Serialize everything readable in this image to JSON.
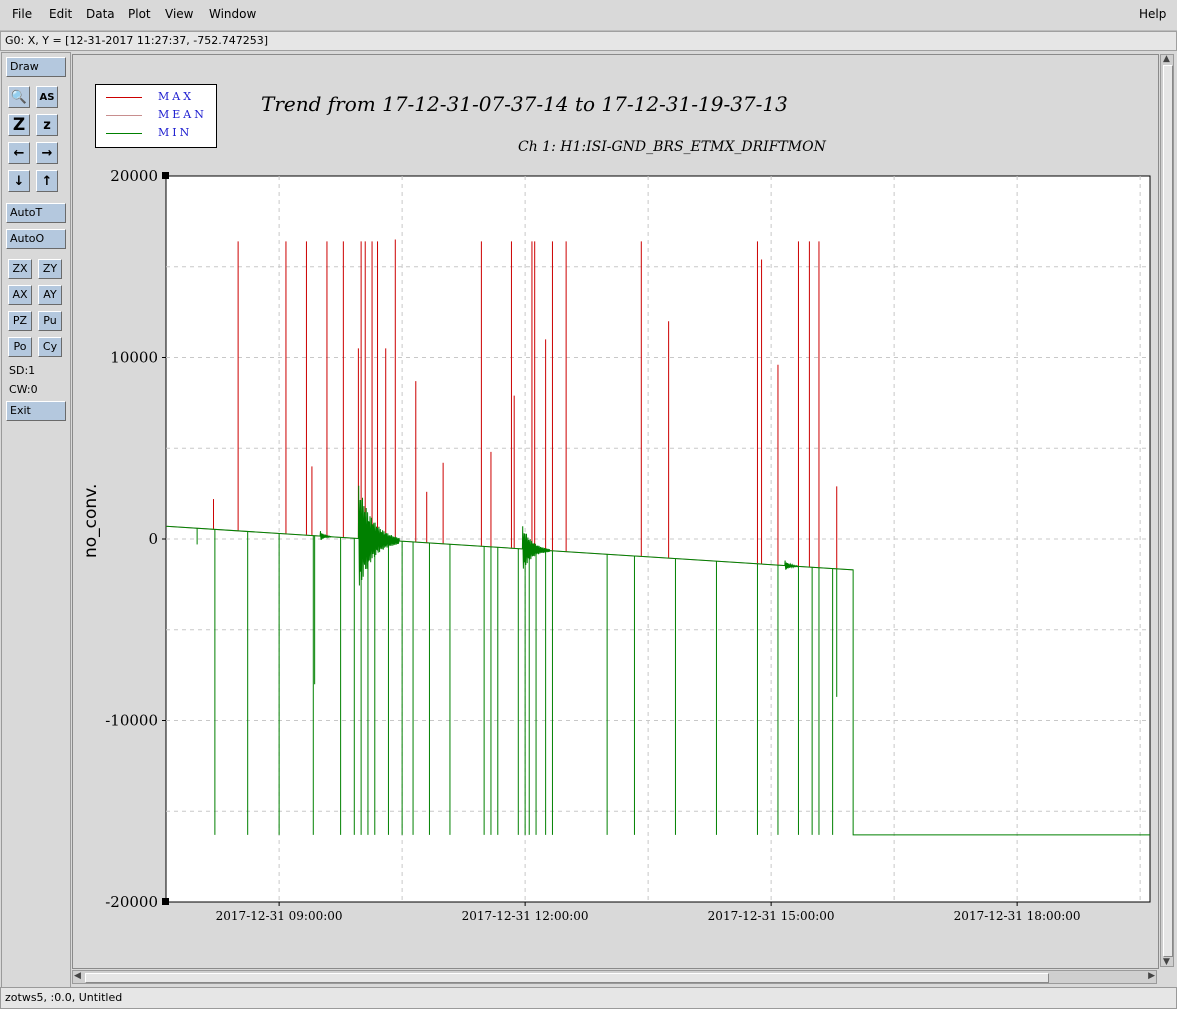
{
  "menubar": {
    "items": [
      "File",
      "Edit",
      "Data",
      "Plot",
      "View",
      "Window"
    ],
    "help": "Help"
  },
  "coordinate_readout": "G0: X, Y = [12-31-2017 11:27:37, -752.747253]",
  "sidebar": {
    "draw": "Draw",
    "icons": [
      "magnify-icon",
      "autoscale-icon",
      "zoom-out-icon",
      "zoom-in-icon",
      "pan-left-icon",
      "pan-right-icon",
      "pan-down-icon",
      "pan-up-icon"
    ],
    "icon_glyphs": [
      "🔍",
      "AS",
      "Z",
      "z",
      "←",
      "→",
      "↓",
      "↑"
    ],
    "autot": "AutoT",
    "autoo": "AutoO",
    "small_buttons": [
      "ZX",
      "ZY",
      "AX",
      "AY",
      "PZ",
      "Pu",
      "Po",
      "Cy"
    ],
    "sd": "SD:1",
    "cw": "CW:0",
    "exit": "Exit"
  },
  "status": "zotws5, :0.0, Untitled",
  "colors": {
    "max": "#cc0000",
    "mean": "#c88e8e",
    "min": "#008000",
    "button": "#b4c8de"
  },
  "chart_data": {
    "type": "line",
    "title": "Trend from 17-12-31-07-37-14 to 17-12-31-19-37-13",
    "subtitle": "Ch 1: H1:ISI-GND_BRS_ETMX_DRIFTMON",
    "ylabel": "no_conv.",
    "xlabel": "",
    "ylim": [
      -20000,
      20000
    ],
    "xlim": [
      "2017-12-31 07:37:14",
      "2017-12-31 19:37:13"
    ],
    "yticks": [
      "20000",
      "10000",
      "0",
      "-10000",
      "-20000"
    ],
    "ytick_values": [
      20000,
      10000,
      0,
      -10000,
      -20000
    ],
    "xticks": [
      "2017-12-31 09:00:00",
      "2017-12-31 12:00:00",
      "2017-12-31 15:00:00",
      "2017-12-31 18:00:00"
    ],
    "grid": true,
    "legend_position": "top-left",
    "legend": [
      "MAX",
      "MEAN",
      "MIN"
    ],
    "baseline": {
      "start_time": "2017-12-31 07:37:14",
      "start_value": 700,
      "end_time": "2017-12-31 16:00:00",
      "end_value": -1700,
      "drop_time": "2017-12-31 16:00:00",
      "drop_value": -16300,
      "flat_end_time": "2017-12-31 19:37:13"
    },
    "max_spikes": [
      {
        "t": "2017-12-31 08:12:00",
        "v": 2200
      },
      {
        "t": "2017-12-31 08:30:00",
        "v": 16400
      },
      {
        "t": "2017-12-31 09:05:00",
        "v": 16400
      },
      {
        "t": "2017-12-31 09:20:00",
        "v": 16400
      },
      {
        "t": "2017-12-31 09:24:00",
        "v": 4000
      },
      {
        "t": "2017-12-31 09:35:00",
        "v": 16400
      },
      {
        "t": "2017-12-31 09:47:00",
        "v": 16400
      },
      {
        "t": "2017-12-31 09:58:00",
        "v": 10500
      },
      {
        "t": "2017-12-31 10:00:00",
        "v": 16400
      },
      {
        "t": "2017-12-31 10:03:00",
        "v": 16400
      },
      {
        "t": "2017-12-31 10:08:00",
        "v": 16400
      },
      {
        "t": "2017-12-31 10:12:00",
        "v": 16400
      },
      {
        "t": "2017-12-31 10:18:00",
        "v": 10500
      },
      {
        "t": "2017-12-31 10:25:00",
        "v": 16500
      },
      {
        "t": "2017-12-31 10:40:00",
        "v": 8700
      },
      {
        "t": "2017-12-31 10:48:00",
        "v": 2600
      },
      {
        "t": "2017-12-31 11:00:00",
        "v": 4200
      },
      {
        "t": "2017-12-31 11:28:00",
        "v": 16400
      },
      {
        "t": "2017-12-31 11:35:00",
        "v": 4800
      },
      {
        "t": "2017-12-31 11:50:00",
        "v": 16400
      },
      {
        "t": "2017-12-31 11:52:00",
        "v": 7900
      },
      {
        "t": "2017-12-31 12:05:00",
        "v": 16400
      },
      {
        "t": "2017-12-31 12:07:00",
        "v": 16400
      },
      {
        "t": "2017-12-31 12:15:00",
        "v": 11000
      },
      {
        "t": "2017-12-31 12:20:00",
        "v": 16400
      },
      {
        "t": "2017-12-31 12:30:00",
        "v": 16400
      },
      {
        "t": "2017-12-31 13:25:00",
        "v": 16400
      },
      {
        "t": "2017-12-31 13:45:00",
        "v": 12000
      },
      {
        "t": "2017-12-31 14:50:00",
        "v": 16400
      },
      {
        "t": "2017-12-31 14:53:00",
        "v": 15400
      },
      {
        "t": "2017-12-31 15:05:00",
        "v": 9600
      },
      {
        "t": "2017-12-31 15:20:00",
        "v": 16400
      },
      {
        "t": "2017-12-31 15:28:00",
        "v": 16400
      },
      {
        "t": "2017-12-31 15:35:00",
        "v": 16400
      },
      {
        "t": "2017-12-31 15:48:00",
        "v": 2900
      }
    ],
    "min_spikes": [
      {
        "t": "2017-12-31 08:00:00",
        "v": -300
      },
      {
        "t": "2017-12-31 08:13:00",
        "v": -16300
      },
      {
        "t": "2017-12-31 08:37:00",
        "v": -16300
      },
      {
        "t": "2017-12-31 09:00:00",
        "v": -16300
      },
      {
        "t": "2017-12-31 09:25:00",
        "v": -16300
      },
      {
        "t": "2017-12-31 09:26:00",
        "v": -8000
      },
      {
        "t": "2017-12-31 09:45:00",
        "v": -16300
      },
      {
        "t": "2017-12-31 09:55:00",
        "v": -16300
      },
      {
        "t": "2017-12-31 10:00:00",
        "v": -16300
      },
      {
        "t": "2017-12-31 10:05:00",
        "v": -16300
      },
      {
        "t": "2017-12-31 10:10:00",
        "v": -16300
      },
      {
        "t": "2017-12-31 10:20:00",
        "v": -16300
      },
      {
        "t": "2017-12-31 10:30:00",
        "v": -16300
      },
      {
        "t": "2017-12-31 10:38:00",
        "v": -16300
      },
      {
        "t": "2017-12-31 10:50:00",
        "v": -16300
      },
      {
        "t": "2017-12-31 11:05:00",
        "v": -16300
      },
      {
        "t": "2017-12-31 11:30:00",
        "v": -16300
      },
      {
        "t": "2017-12-31 11:35:00",
        "v": -16300
      },
      {
        "t": "2017-12-31 11:40:00",
        "v": -16300
      },
      {
        "t": "2017-12-31 11:55:00",
        "v": -16300
      },
      {
        "t": "2017-12-31 12:00:00",
        "v": -16300
      },
      {
        "t": "2017-12-31 12:03:00",
        "v": -16300
      },
      {
        "t": "2017-12-31 12:08:00",
        "v": -16300
      },
      {
        "t": "2017-12-31 12:15:00",
        "v": -16300
      },
      {
        "t": "2017-12-31 12:20:00",
        "v": -16300
      },
      {
        "t": "2017-12-31 13:00:00",
        "v": -16300
      },
      {
        "t": "2017-12-31 13:20:00",
        "v": -16300
      },
      {
        "t": "2017-12-31 13:50:00",
        "v": -16300
      },
      {
        "t": "2017-12-31 14:20:00",
        "v": -16300
      },
      {
        "t": "2017-12-31 14:50:00",
        "v": -16300
      },
      {
        "t": "2017-12-31 15:05:00",
        "v": -16300
      },
      {
        "t": "2017-12-31 15:20:00",
        "v": -16300
      },
      {
        "t": "2017-12-31 15:30:00",
        "v": -16300
      },
      {
        "t": "2017-12-31 15:35:00",
        "v": -16300
      },
      {
        "t": "2017-12-31 15:45:00",
        "v": -16300
      },
      {
        "t": "2017-12-31 15:48:00",
        "v": -8700
      }
    ],
    "oscillation_bursts": [
      {
        "t": "2017-12-31 09:58:00",
        "amplitude": 3000,
        "duration_min": 30
      },
      {
        "t": "2017-12-31 11:58:00",
        "amplitude": 1300,
        "duration_min": 20
      },
      {
        "t": "2017-12-31 09:30:00",
        "amplitude": 300,
        "duration_min": 8
      },
      {
        "t": "2017-12-31 15:10:00",
        "amplitude": 300,
        "duration_min": 10
      }
    ]
  }
}
